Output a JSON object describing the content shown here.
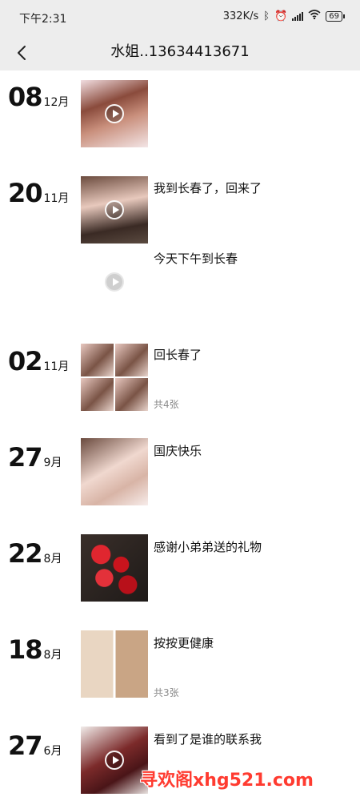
{
  "status_bar": {
    "time": "下午2:31",
    "speed": "332K/s",
    "battery": "69"
  },
  "nav": {
    "title": "水姐..13634413671"
  },
  "entries": [
    {
      "day": "08",
      "month": "12月",
      "caption": "",
      "count": ""
    },
    {
      "day": "20",
      "month": "11月",
      "caption": "我到长春了，回来了",
      "caption2": "今天下午到长春",
      "count": ""
    },
    {
      "day": "02",
      "month": "11月",
      "caption": "回长春了",
      "count": "共4张"
    },
    {
      "day": "27",
      "month": "9月",
      "caption": "国庆快乐",
      "count": ""
    },
    {
      "day": "22",
      "month": "8月",
      "caption": "感谢小弟弟送的礼物",
      "count": ""
    },
    {
      "day": "18",
      "month": "8月",
      "caption": "按按更健康",
      "count": "共3张"
    },
    {
      "day": "27",
      "month": "6月",
      "caption": "看到了是谁的联系我",
      "count": ""
    }
  ],
  "watermark": "寻欢阁xhg521.com"
}
